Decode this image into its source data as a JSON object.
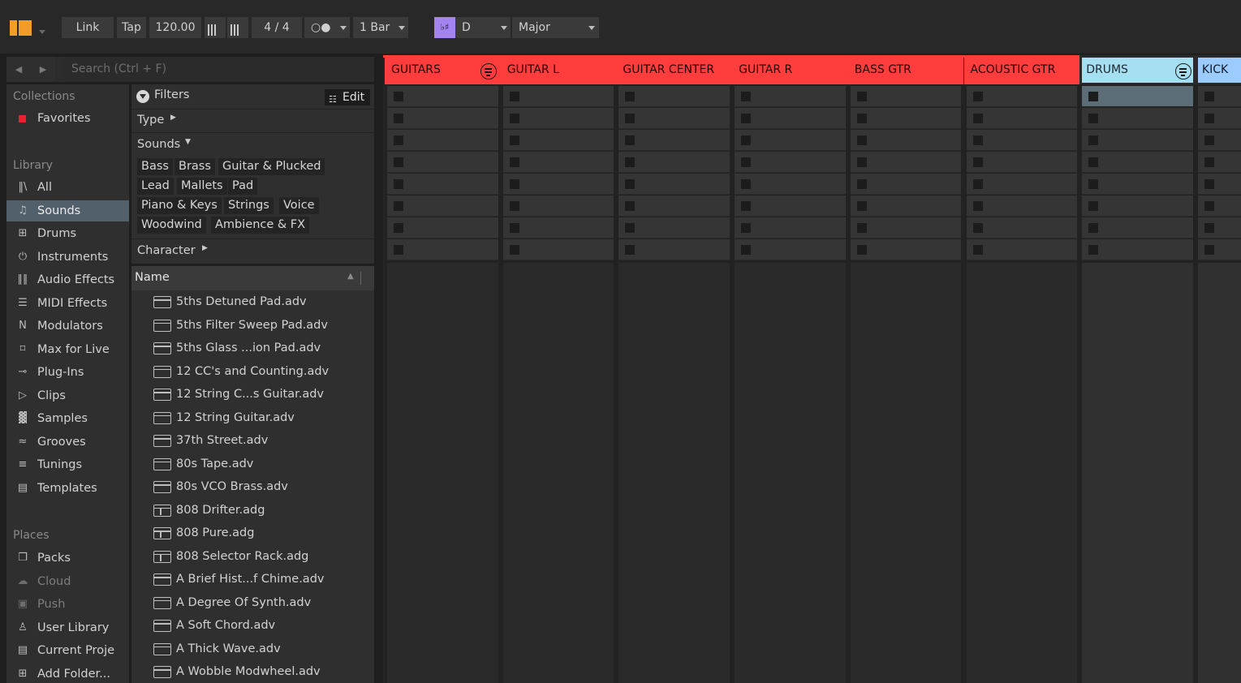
{
  "topbar": {
    "link": "Link",
    "tap": "Tap",
    "tempo": "120.00",
    "signature": "4 / 4",
    "metronome": "○●",
    "quantize": "1 Bar",
    "scale_key": "D",
    "scale_mode": "Major"
  },
  "browser": {
    "search_placeholder": "Search (Ctrl + F)",
    "collections_title": "Collections",
    "favorites": "Favorites",
    "library_title": "Library",
    "library": [
      {
        "label": "All",
        "icon": "all-icon",
        "glyph": "‖\\"
      },
      {
        "label": "Sounds",
        "icon": "sounds-icon",
        "glyph": "♫"
      },
      {
        "label": "Drums",
        "icon": "drums-icon",
        "glyph": "⊞"
      },
      {
        "label": "Instruments",
        "icon": "instruments-icon",
        "glyph": "⏻"
      },
      {
        "label": "Audio Effects",
        "icon": "audio-effects-icon",
        "glyph": "∥∥"
      },
      {
        "label": "MIDI Effects",
        "icon": "midi-effects-icon",
        "glyph": "☰"
      },
      {
        "label": "Modulators",
        "icon": "modulators-icon",
        "glyph": "N"
      },
      {
        "label": "Max for Live",
        "icon": "max-for-live-icon",
        "glyph": "⌑"
      },
      {
        "label": "Plug-Ins",
        "icon": "plug-ins-icon",
        "glyph": "⊸"
      },
      {
        "label": "Clips",
        "icon": "clips-icon",
        "glyph": "▷"
      },
      {
        "label": "Samples",
        "icon": "samples-icon",
        "glyph": "▓"
      },
      {
        "label": "Grooves",
        "icon": "grooves-icon",
        "glyph": "≈"
      },
      {
        "label": "Tunings",
        "icon": "tunings-icon",
        "glyph": "≡"
      },
      {
        "label": "Templates",
        "icon": "templates-icon",
        "glyph": "▤"
      }
    ],
    "places_title": "Places",
    "places": [
      {
        "label": "Packs",
        "icon": "packs-icon",
        "glyph": "❐"
      },
      {
        "label": "Cloud",
        "icon": "cloud-icon",
        "glyph": "☁"
      },
      {
        "label": "Push",
        "icon": "push-icon",
        "glyph": "▣"
      },
      {
        "label": "User Library",
        "icon": "user-library-icon",
        "glyph": "♙"
      },
      {
        "label": "Current Proje",
        "icon": "current-project-icon",
        "glyph": "▤"
      },
      {
        "label": "Add Folder...",
        "icon": "add-folder-icon",
        "glyph": "⊞"
      }
    ],
    "filters_label": "Filters",
    "edit_label": "Edit",
    "type_label": "Type",
    "sounds_label": "Sounds",
    "sound_tags": [
      "Bass",
      "Brass",
      "Guitar & Plucked",
      "Lead",
      "Mallets",
      "Pad",
      "Piano & Keys",
      "Strings",
      "Voice",
      "Woodwind",
      "Ambience & FX"
    ],
    "character_label": "Character",
    "name_header": "Name",
    "files": [
      {
        "name": "5ths Detuned Pad.adv",
        "kind": "preset"
      },
      {
        "name": "5ths Filter Sweep Pad.adv",
        "kind": "preset"
      },
      {
        "name": "5ths Glass ...ion Pad.adv",
        "kind": "preset"
      },
      {
        "name": "12 CC's and Counting.adv",
        "kind": "preset"
      },
      {
        "name": "12 String C...s Guitar.adv",
        "kind": "preset"
      },
      {
        "name": "12 String Guitar.adv",
        "kind": "preset"
      },
      {
        "name": "37th Street.adv",
        "kind": "preset"
      },
      {
        "name": "80s Tape.adv",
        "kind": "preset"
      },
      {
        "name": "80s VCO Brass.adv",
        "kind": "preset"
      },
      {
        "name": "808 Drifter.adg",
        "kind": "rack"
      },
      {
        "name": "808 Pure.adg",
        "kind": "rack"
      },
      {
        "name": "808 Selector Rack.adg",
        "kind": "rack"
      },
      {
        "name": "A Brief Hist...f Chime.adv",
        "kind": "preset"
      },
      {
        "name": "A Degree Of Synth.adv",
        "kind": "preset"
      },
      {
        "name": "A Soft Chord.adv",
        "kind": "preset"
      },
      {
        "name": "A Thick Wave.adv",
        "kind": "preset"
      },
      {
        "name": "A Wobble Modwheel.adv",
        "kind": "preset"
      }
    ]
  },
  "session": {
    "tracks": [
      {
        "name": "GUITARS",
        "color": "#ff3d3d",
        "text": "#2a0000",
        "group": true
      },
      {
        "name": "GUITAR L",
        "color": "#ff3d3d",
        "text": "#2a0000",
        "group": false
      },
      {
        "name": "GUITAR CENTER",
        "color": "#ff3d3d",
        "text": "#2a0000",
        "group": false
      },
      {
        "name": "GUITAR R",
        "color": "#ff3d3d",
        "text": "#2a0000",
        "group": false
      },
      {
        "name": "BASS GTR",
        "color": "#ff3d3d",
        "text": "#2a0000",
        "group": false
      },
      {
        "name": "ACOUSTIC GTR",
        "color": "#ff3d3d",
        "text": "#2a0000",
        "group": false
      },
      {
        "name": "DRUMS",
        "color": "#a6dff2",
        "text": "#1c2a30",
        "group": true
      },
      {
        "name": "KICK",
        "color": "#9ccbff",
        "text": "#101a28",
        "group": false
      }
    ],
    "scene_count": 8,
    "selected_slot": {
      "track": 6,
      "scene": 0
    }
  },
  "colors": {
    "accent_orange": "#f39c28",
    "selection": "#52606b",
    "group_red": "#ff3d3d",
    "group_blue": "#a6dff2",
    "scale_purple": "#a383f0"
  }
}
